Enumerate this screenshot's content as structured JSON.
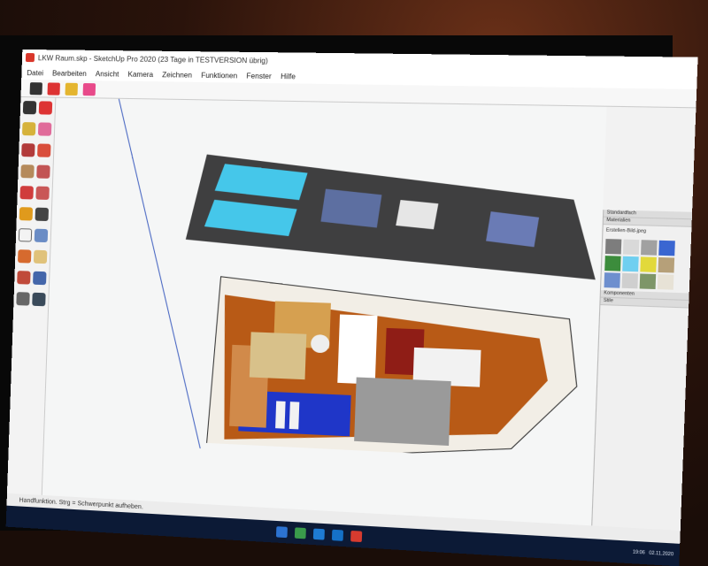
{
  "window": {
    "title": "LKW Raum.skp - SketchUp Pro 2020 (23 Tage in TESTVERSION übrig)",
    "menu": [
      "Datei",
      "Bearbeiten",
      "Ansicht",
      "Kamera",
      "Zeichnen",
      "Funktionen",
      "Fenster",
      "Hilfe"
    ]
  },
  "status": {
    "text": "Handfunktion. Strg = Schwerpunkt aufheben."
  },
  "left_tools_icons": [
    "select-icon",
    "eraser-icon",
    "paint-icon",
    "line-icon",
    "arc-icon",
    "rectangle-icon",
    "pushpull-icon",
    "move-icon",
    "rotate-icon",
    "scale-icon",
    "offset-icon",
    "tape-icon",
    "text-icon",
    "axes-icon",
    "orbit-icon",
    "pan-icon",
    "zoom-icon",
    "zoomext-icon",
    "walk-icon",
    "section-icon"
  ],
  "right_panel": {
    "headers": [
      "Standardfach",
      "Materialien",
      "Komponenten",
      "Stile"
    ],
    "selected_material": "Erstellen-Bild-jpeg"
  },
  "taskbar": {
    "time": "19:06",
    "date": "02.11.2020"
  },
  "colors": {
    "wood": "#b85a16",
    "darkred": "#8b1b12",
    "blue": "#1f36c8",
    "cyan": "#43c9ea",
    "panel": "#404040"
  }
}
